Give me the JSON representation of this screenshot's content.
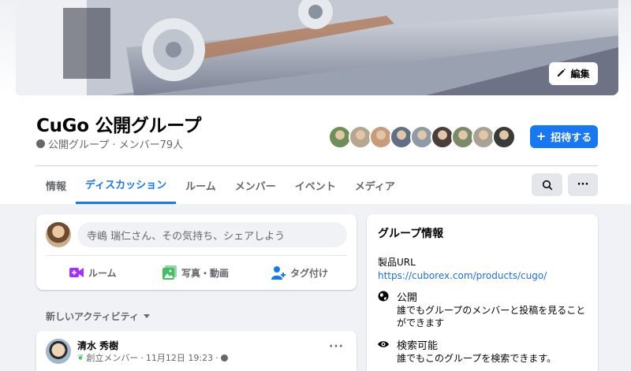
{
  "cover": {
    "edit_label": "編集"
  },
  "group": {
    "name": "CuGo 公開グループ",
    "meta": "公開グループ · メンバー79人",
    "avatar_colors": [
      "#6f8f5a",
      "#b6a58f",
      "#c89c7a",
      "#5f6f86",
      "#8e9aa6",
      "#4c3d3d",
      "#7a8b6a",
      "#a7a294",
      "#3a3a3a"
    ]
  },
  "header": {
    "invite_label": "招待する",
    "tabs": [
      "情報",
      "ディスカッション",
      "ルーム",
      "メンバー",
      "イベント",
      "メディア"
    ],
    "active_tab": "ディスカッション",
    "more_label": "···"
  },
  "composer": {
    "placeholder": "寺嶋 瑞仁さん、その気持ち、シェアしよう",
    "actions": [
      {
        "label": "ルーム",
        "icon": "video-room-icon",
        "color": "#a033ff"
      },
      {
        "label": "写真・動画",
        "icon": "photo-icon",
        "color": "#45bd62"
      },
      {
        "label": "タグ付け",
        "icon": "tag-people-icon",
        "color": "#1877f2"
      }
    ]
  },
  "feed": {
    "sort_label": "新しいアクティビティ"
  },
  "post": {
    "author": "清水 秀樹",
    "role": "創立メンバー",
    "date": "11月12日 19:23",
    "more": "···"
  },
  "info": {
    "title": "グループ情報",
    "product_url_label": "製品URL",
    "product_url": "https://cuborex.com/products/cugo/",
    "items": [
      {
        "title": "公開",
        "desc": "誰でもグループのメンバーと投稿を見ることができます",
        "icon": "globe-icon"
      },
      {
        "title": "検索可能",
        "desc": "誰でもこのグループを検索できます。",
        "icon": "eye-icon"
      }
    ]
  },
  "colors": {
    "accent": "#1877f2",
    "background": "#f0f2f5"
  }
}
